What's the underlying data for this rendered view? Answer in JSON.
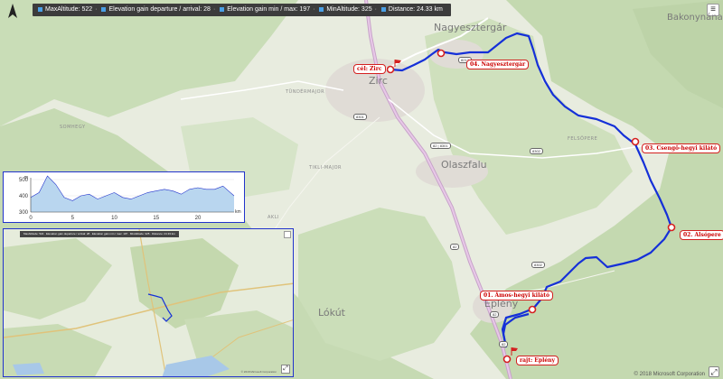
{
  "stats": [
    {
      "label": "MaxAltitude:",
      "value": "522"
    },
    {
      "label": "Elevation gain departure / arrival:",
      "value": "28"
    },
    {
      "label": "Elevation gain min / max:",
      "value": "197"
    },
    {
      "label": "MinAltitude:",
      "value": "325"
    },
    {
      "label": "Distance:",
      "value": "24.33 km"
    }
  ],
  "places": {
    "nagyesztergar": "Nagyesztergár",
    "bakonynana": "Bakonynána",
    "zirc": "Zirc",
    "olaszfalu": "Olaszfalu",
    "lokut": "Lókút",
    "eplény": "Eplény",
    "tundermajor": "TÜNDÉRMAJOR",
    "somhegy": "SOMHEGY",
    "felsopere": "FELSŐPERE",
    "tikli_major": "TIKLI-MAJOR",
    "akli": "AKLI"
  },
  "roads": {
    "r8212": "8212",
    "r8301": "8301",
    "r82_a": "82 | 8301",
    "r8302": "8302",
    "r82_b": "82",
    "r8302b": "8302",
    "r82_c": "82",
    "r82_d": "82"
  },
  "pois": [
    {
      "id": "zirc",
      "label": "cél: Zirc"
    },
    {
      "id": "nagyesztergar",
      "label": "04. Nagyesztergár"
    },
    {
      "id": "csengohegy",
      "label": "03. Csengő-hegyi kilátó"
    },
    {
      "id": "alsopere",
      "label": "02. Alsópere"
    },
    {
      "id": "amos",
      "label": "01. Ámos-hegyi kilátó"
    },
    {
      "id": "eplény",
      "label": "rajt: Eplény"
    }
  ],
  "copyright": "© 2018 Microsoft Corporation",
  "menu_icon": "≡",
  "expand_icon": "⤢",
  "profile": {
    "y_unit": "m",
    "x_unit": "km",
    "y_ticks": [
      "500",
      "400",
      "300"
    ],
    "x_ticks": [
      "0",
      "5",
      "10",
      "15",
      "20"
    ],
    "ylim": [
      300,
      500
    ],
    "xlim": [
      0,
      24.33
    ],
    "line_color": "#2233cc",
    "fill_color": "#b9d6ef"
  },
  "chart_data": {
    "type": "area",
    "xlabel": "km",
    "ylabel": "m",
    "x": [
      0,
      1,
      2,
      3,
      4,
      5,
      6,
      7,
      8,
      9,
      10,
      11,
      12,
      13,
      14,
      15,
      16,
      17,
      18,
      19,
      20,
      21,
      22,
      23,
      24.33
    ],
    "y": [
      390,
      420,
      522,
      470,
      390,
      370,
      400,
      410,
      380,
      400,
      420,
      390,
      380,
      400,
      420,
      430,
      440,
      430,
      410,
      440,
      450,
      440,
      440,
      460,
      400
    ],
    "ylim": [
      300,
      500
    ],
    "xlim": [
      0,
      24.33
    ]
  },
  "minimap": {
    "stats_text": "MaxAltitude: 522 · Elevation gain departure / arrival: 28 · Elevation gain min / max: 197 · MinAltitude: 325 · Distance: 24.33 km",
    "copyright": "© 2018 Microsoft Corporation"
  },
  "colors": {
    "route": "#1530d8",
    "poi": "#d42020",
    "forest": "#c8dcb6",
    "open": "#e8ecdf"
  }
}
